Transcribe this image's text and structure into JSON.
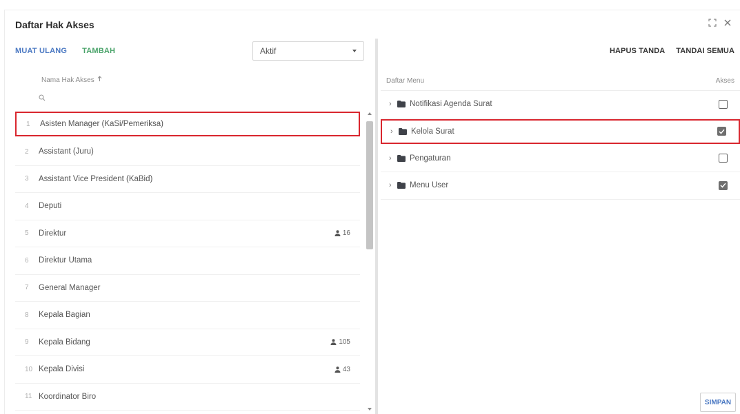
{
  "dialog": {
    "title": "Daftar Hak Akses"
  },
  "left": {
    "reload_label": "MUAT ULANG",
    "add_label": "TAMBAH",
    "status_select": "Aktif",
    "column_header": "Nama Hak Akses",
    "search_placeholder": "",
    "rows": [
      {
        "num": "1",
        "name": "Asisten Manager (KaSi/Pemeriksa)",
        "count": ""
      },
      {
        "num": "2",
        "name": "Assistant (Juru)",
        "count": ""
      },
      {
        "num": "3",
        "name": "Assistant Vice President (KaBid)",
        "count": ""
      },
      {
        "num": "4",
        "name": "Deputi",
        "count": ""
      },
      {
        "num": "5",
        "name": "Direktur",
        "count": "16"
      },
      {
        "num": "6",
        "name": "Direktur Utama",
        "count": ""
      },
      {
        "num": "7",
        "name": "General Manager",
        "count": ""
      },
      {
        "num": "8",
        "name": "Kepala Bagian",
        "count": ""
      },
      {
        "num": "9",
        "name": "Kepala Bidang",
        "count": "105"
      },
      {
        "num": "10",
        "name": "Kepala Divisi",
        "count": "43"
      },
      {
        "num": "11",
        "name": "Koordinator Biro",
        "count": ""
      }
    ]
  },
  "right": {
    "clear_label": "HAPUS TANDA",
    "mark_all_label": "TANDAI SEMUA",
    "menu_header": "Daftar Menu",
    "access_header": "Akses",
    "menus": [
      {
        "label": "Notifikasi Agenda Surat",
        "checked": false
      },
      {
        "label": "Kelola Surat",
        "checked": true
      },
      {
        "label": "Pengaturan",
        "checked": false
      },
      {
        "label": "Menu User",
        "checked": true
      }
    ],
    "save_label": "SIMPAN"
  },
  "colors": {
    "highlight": "#d9262e",
    "primary": "#4a78c2",
    "secondary": "#4aa36a"
  }
}
